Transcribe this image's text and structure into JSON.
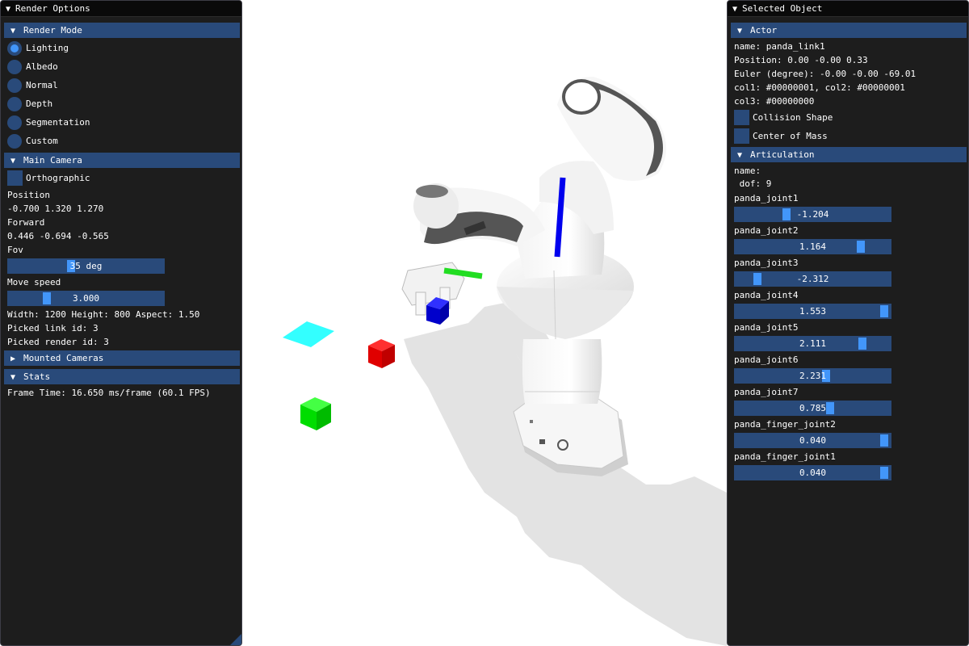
{
  "colors": {
    "panel_bg": "#0f0f0f",
    "header_bg": "#294a7a",
    "accent": "#4296fa",
    "scene_bg": "#ffffff",
    "cube_red": "#dd0000",
    "cube_green": "#00cc00",
    "cube_blue": "#0000dd",
    "marker_cyan": "#33ffff"
  },
  "render_options": {
    "title": "Render Options",
    "render_mode": {
      "header": "Render Mode",
      "options": [
        "Lighting",
        "Albedo",
        "Normal",
        "Depth",
        "Segmentation",
        "Custom"
      ],
      "selected": "Lighting"
    },
    "main_camera": {
      "header": "Main Camera",
      "orthographic_label": "Orthographic",
      "orthographic_checked": false,
      "position_label": "Position",
      "position_value": "-0.700 1.320 1.270",
      "forward_label": "Forward",
      "forward_value": "0.446 -0.694 -0.565",
      "fov_label": "Fov",
      "fov_value": "35 deg",
      "fov_level": 0.4,
      "move_speed_label": "Move speed",
      "move_speed_value": "3.000",
      "move_speed_level": 0.23,
      "size_text": "Width: 1200 Height: 800 Aspect: 1.50",
      "picked_link": "Picked link id: 3",
      "picked_render": "Picked render id: 3"
    },
    "mounted_cameras": {
      "header": "Mounted Cameras"
    },
    "stats": {
      "header": "Stats",
      "frame_time": "Frame Time: 16.650 ms/frame (60.1 FPS)"
    }
  },
  "selected_object": {
    "title": "Selected Object",
    "actor": {
      "header": "Actor",
      "name_line": "name: panda_link1",
      "position_line": "Position: 0.00 -0.00 0.33",
      "euler_line": "Euler (degree): -0.00 -0.00 -69.01",
      "col_line1": "col1: #00000001, col2: #00000001",
      "col_line2": "col3: #00000000",
      "collision_shape_label": "Collision Shape",
      "center_of_mass_label": "Center of Mass"
    },
    "articulation": {
      "header": "Articulation",
      "name_line": "name:",
      "dof_line": " dof: 9",
      "joints": [
        {
          "name": "panda_joint1",
          "value": "-1.204",
          "level": 0.32
        },
        {
          "name": "panda_joint2",
          "value": "1.164",
          "level": 0.83
        },
        {
          "name": "panda_joint3",
          "value": "-2.312",
          "level": 0.12
        },
        {
          "name": "panda_joint4",
          "value": "1.553",
          "level": 0.99
        },
        {
          "name": "panda_joint5",
          "value": "2.111",
          "level": 0.84
        },
        {
          "name": "panda_joint6",
          "value": "2.231",
          "level": 0.59
        },
        {
          "name": "panda_joint7",
          "value": "0.785",
          "level": 0.62
        },
        {
          "name": "panda_finger_joint2",
          "value": "0.040",
          "level": 0.99
        },
        {
          "name": "panda_finger_joint1",
          "value": "0.040",
          "level": 0.99
        }
      ]
    }
  }
}
